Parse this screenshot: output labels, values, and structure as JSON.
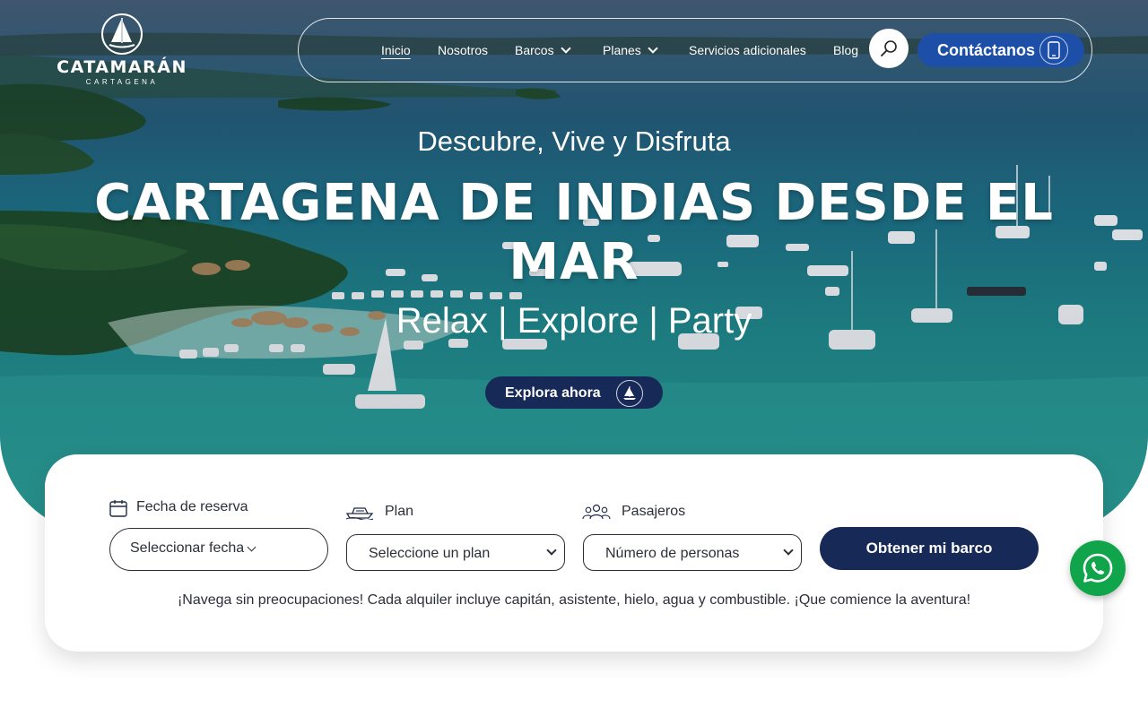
{
  "brand": {
    "name": "CATAMARÁN",
    "tagline": "CARTAGENA"
  },
  "nav": {
    "items": [
      {
        "label": "Inicio",
        "active": true
      },
      {
        "label": "Nosotros"
      },
      {
        "label": "Barcos",
        "dropdown": true
      },
      {
        "label": "Planes",
        "dropdown": true
      },
      {
        "label": "Servicios adicionales"
      },
      {
        "label": "Blog"
      }
    ],
    "search_icon": "search-icon",
    "contact_label": "Contáctanos",
    "contact_icon": "phone-icon"
  },
  "hero": {
    "tagline": "Descubre, Vive y Disfruta",
    "headline": "CARTAGENA DE INDIAS DESDE EL MAR",
    "subline": "Relax | Explore | Party",
    "cta_label": "Explora ahora",
    "cta_icon": "sailboat-icon"
  },
  "booking": {
    "date_label": "Fecha de reserva",
    "date_icon": "calendar-icon",
    "date_value": "Seleccionar fecha",
    "plan_label": "Plan",
    "plan_icon": "boat-icon",
    "plan_value": "Seleccione un plan",
    "pax_label": "Pasajeros",
    "pax_icon": "people-icon",
    "pax_value": "Número de personas",
    "submit_label": "Obtener mi barco",
    "note": "¡Navega sin preocupaciones! Cada alquiler incluye capitán, asistente, hielo, agua y combustible. ¡Que comience la aventura!"
  },
  "whatsapp_icon": "whatsapp-icon",
  "colors": {
    "navy": "#172a57",
    "contact_blue": "#1e4fa8",
    "whatsapp_green": "#10a54a",
    "text_dark": "#2c2f38"
  }
}
